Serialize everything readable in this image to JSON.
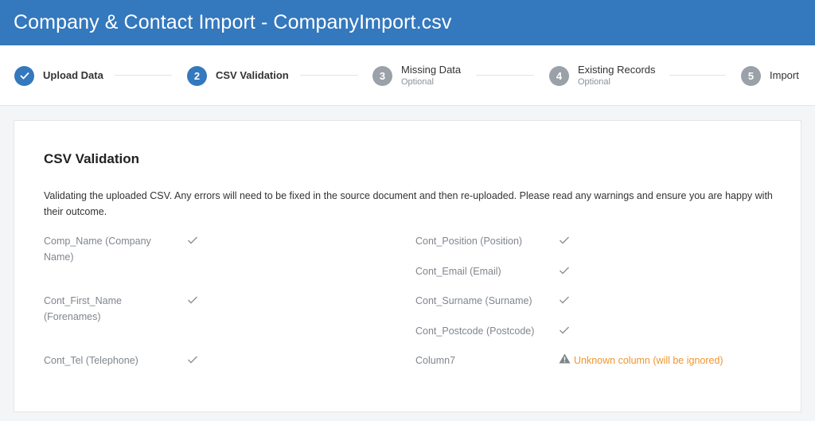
{
  "header": {
    "title": "Company & Contact Import - CompanyImport.csv"
  },
  "steps": [
    {
      "number": "1",
      "label": "Upload Data",
      "sub": "",
      "state": "done"
    },
    {
      "number": "2",
      "label": "CSV Validation",
      "sub": "",
      "state": "active"
    },
    {
      "number": "3",
      "label": "Missing Data",
      "sub": "Optional",
      "state": "todo"
    },
    {
      "number": "4",
      "label": "Existing Records",
      "sub": "Optional",
      "state": "todo"
    },
    {
      "number": "5",
      "label": "Import",
      "sub": "",
      "state": "todo"
    }
  ],
  "card": {
    "title": "CSV Validation",
    "description": "Validating the uploaded CSV. Any errors will need to be fixed in the source document and then re-uploaded. Please read any warnings and ensure you are happy with their outcome."
  },
  "fields_left": [
    {
      "name": "Comp_Name (Company Name)",
      "status": "ok"
    },
    {
      "name": "Cont_First_Name (Forenames)",
      "status": "ok"
    },
    {
      "name": "Cont_Tel (Telephone)",
      "status": "ok"
    }
  ],
  "fields_right": [
    {
      "name": "Cont_Position (Position)",
      "status": "ok"
    },
    {
      "name": "Cont_Email (Email)",
      "status": "ok"
    },
    {
      "name": "Cont_Surname (Surname)",
      "status": "ok"
    },
    {
      "name": "Cont_Postcode (Postcode)",
      "status": "ok"
    },
    {
      "name": "Column7",
      "status": "warning",
      "message": "Unknown column (will be ignored)"
    }
  ],
  "colors": {
    "primary": "#3478bd",
    "inactive_step": "#9aa1a8",
    "warning": "#f0952f",
    "check": "#8a9096"
  }
}
